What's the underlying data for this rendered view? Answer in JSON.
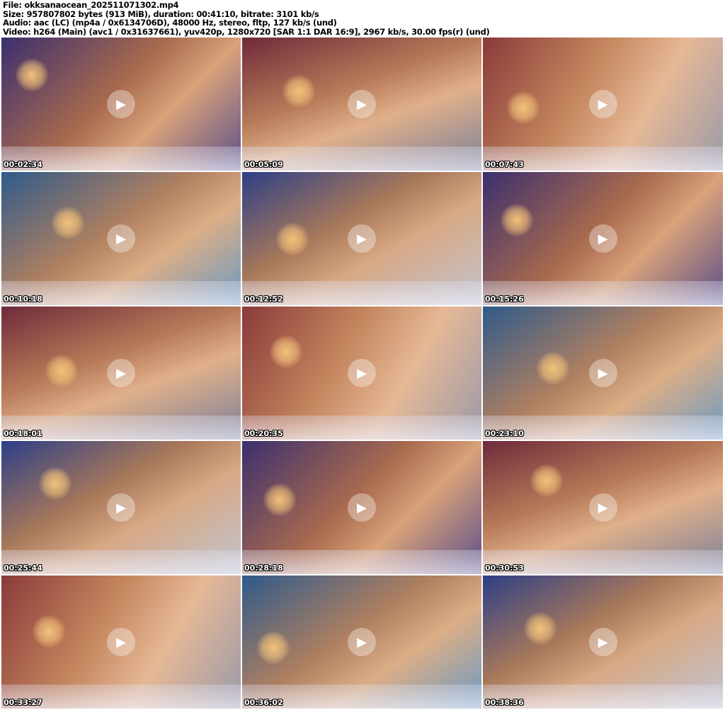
{
  "header": {
    "file": "File: okksanaocean_202511071302.mp4",
    "size": "Size: 957807802 bytes (913 MiB), duration: 00:41:10, bitrate: 3101 kb/s",
    "audio": "Audio: aac (LC) (mp4a / 0x6134706D), 48000 Hz, stereo, fltp, 127 kb/s (und)",
    "video": "Video: h264 (Main) (avc1 / 0x31637661), yuv420p, 1280x720 [SAR 1:1 DAR 16:9], 2967 kb/s, 30.00 fps(r) (und)"
  },
  "thumbnails": [
    {
      "timestamp": "00:02:34"
    },
    {
      "timestamp": "00:05:09"
    },
    {
      "timestamp": "00:07:43"
    },
    {
      "timestamp": "00:10:18"
    },
    {
      "timestamp": "00:12:52"
    },
    {
      "timestamp": "00:15:26"
    },
    {
      "timestamp": "00:18:01"
    },
    {
      "timestamp": "00:20:35"
    },
    {
      "timestamp": "00:23:10"
    },
    {
      "timestamp": "00:25:44"
    },
    {
      "timestamp": "00:28:18"
    },
    {
      "timestamp": "00:30:53"
    },
    {
      "timestamp": "00:33:27"
    },
    {
      "timestamp": "00:36:02"
    },
    {
      "timestamp": "00:38:36"
    }
  ]
}
